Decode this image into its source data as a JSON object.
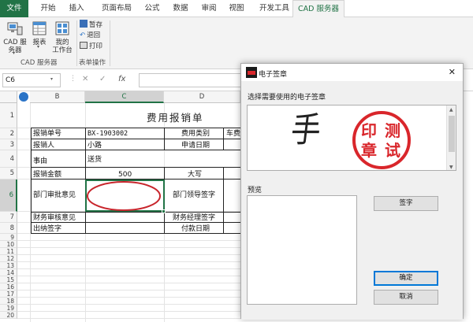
{
  "ribbon": {
    "tabs": [
      "文件",
      "开始",
      "插入",
      "页面布局",
      "公式",
      "数据",
      "审阅",
      "视图",
      "开发工具",
      "CAD 服务器"
    ],
    "buttons": {
      "cad_server": "CAD 服",
      "cad_server_2": "务器",
      "report": "报表",
      "workbench": "我的",
      "workbench_2": "工作台",
      "save_draft": "暂存",
      "return": "退回",
      "print": "打印"
    },
    "groups": {
      "cad_group": "CAD 服务器",
      "form_ops": "表单操作"
    }
  },
  "formula_bar": {
    "name_box": "C6",
    "cancel": "✕",
    "confirm": "✓",
    "fx": "fx"
  },
  "grid": {
    "columns": [
      "B",
      "C",
      "D"
    ],
    "rows": [
      "1",
      "2",
      "3",
      "4",
      "5",
      "6",
      "7",
      "8",
      "9",
      "10",
      "11",
      "12",
      "13",
      "14",
      "15",
      "16",
      "17",
      "18",
      "19",
      "20"
    ],
    "form": {
      "title": "费用报销单",
      "bill_no_label": "报销单号",
      "bill_no": "BX-1903002",
      "expense_type_label": "费用类别",
      "expense_type": "车费",
      "applicant_label": "报销人",
      "applicant": "小路",
      "apply_date_label": "申请日期",
      "reason_label": "事由",
      "reason": "送货",
      "amount_label": "报销金额",
      "amount": "500",
      "uppercase_label": "大写",
      "dept_approval_label": "部门审批意见",
      "dept_leader_label": "部门领导签字",
      "finance_review_label": "财务审核意见",
      "finance_manager_label": "财务经理签字",
      "cashier_label": "出纳签字",
      "pay_date_label": "付款日期"
    }
  },
  "dialog": {
    "title": "电子签章",
    "select_label": "选择需要使用的电子签章",
    "preview_label": "预览",
    "sign_button": "签字",
    "ok_button": "确定",
    "cancel_button": "取消",
    "close": "✕",
    "handwriting": "手",
    "stamp_chars": [
      "印",
      "测",
      "章",
      "试"
    ],
    "stamp_color": "#d9262b"
  },
  "colors": {
    "excel_green": "#217346",
    "oval_red": "#c8252c"
  }
}
